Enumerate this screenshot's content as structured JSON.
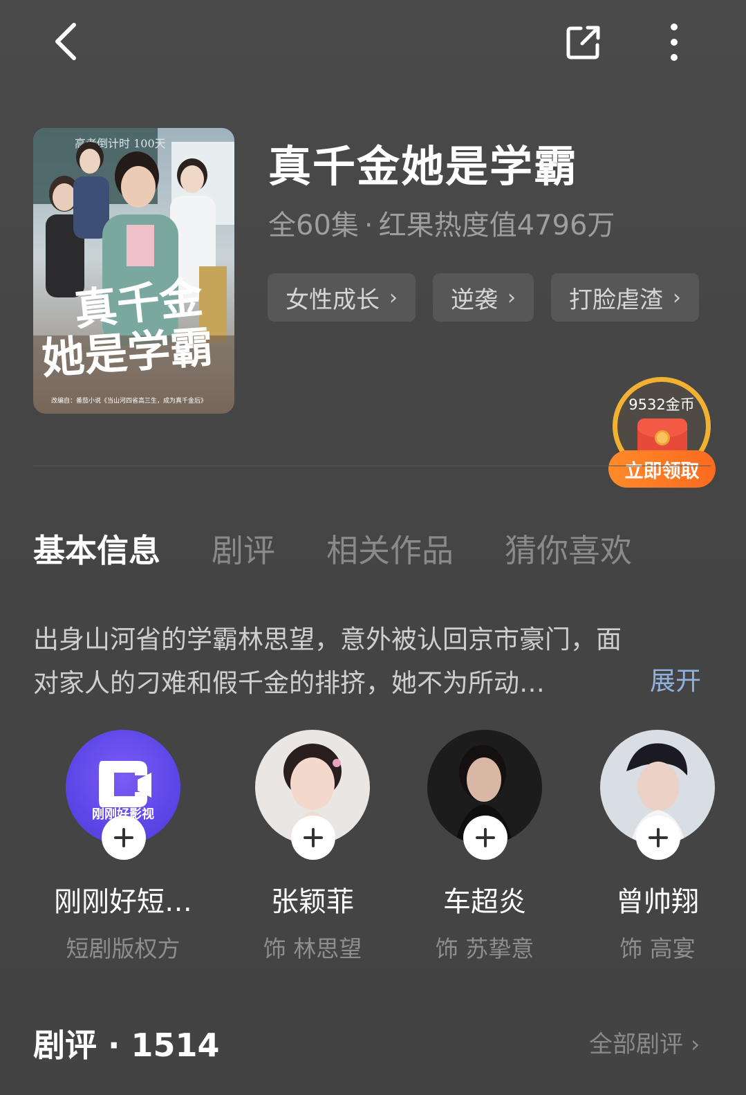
{
  "header": {
    "back_icon": "chevron-left-icon",
    "share_icon": "share-icon",
    "more_icon": "more-vertical-icon"
  },
  "drama": {
    "title": "真千金她是学霸",
    "episodes": "全60集",
    "separator": "·",
    "heat": "红果热度值4796万",
    "poster": {
      "title_line1": "真千金",
      "title_line2": "她是学霸",
      "caption": "改编自：番茄小说《当山河四省高三生，成为真千金后》",
      "chalkboard_text": "高考倒计时 100天"
    },
    "tags": [
      {
        "label": "女性成长"
      },
      {
        "label": "逆袭"
      },
      {
        "label": "打脸虐渣"
      }
    ]
  },
  "reward": {
    "amount": "9532金币",
    "claim_label": "立即领取"
  },
  "tabs": [
    {
      "label": "基本信息",
      "active": true
    },
    {
      "label": "剧评",
      "active": false
    },
    {
      "label": "相关作品",
      "active": false
    },
    {
      "label": "猜你喜欢",
      "active": false
    }
  ],
  "synopsis": {
    "line1": "出身山河省的学霸林思望，意外被认回京市豪门，面",
    "line2": "对家人的刁难和假千金的排挤，她不为所动…",
    "expand_label": "展开"
  },
  "cast": [
    {
      "name": "刚刚好短…",
      "role": "短剧版权方",
      "logo_text": "刚刚好影视"
    },
    {
      "name": "张颖菲",
      "role": "饰 林思望"
    },
    {
      "name": "车超炎",
      "role": "饰 苏挚意"
    },
    {
      "name": "曾帅翔",
      "role": "饰 高宴"
    }
  ],
  "reviews": {
    "title": "剧评 · 1514",
    "all_label": "全部剧评"
  },
  "colors": {
    "background": "#474747",
    "accent_link": "#8fb3dc",
    "claim_orange": "#fb6a1f",
    "coin_ring": "#f1b133",
    "brand_purple": "#6a4cf0"
  }
}
